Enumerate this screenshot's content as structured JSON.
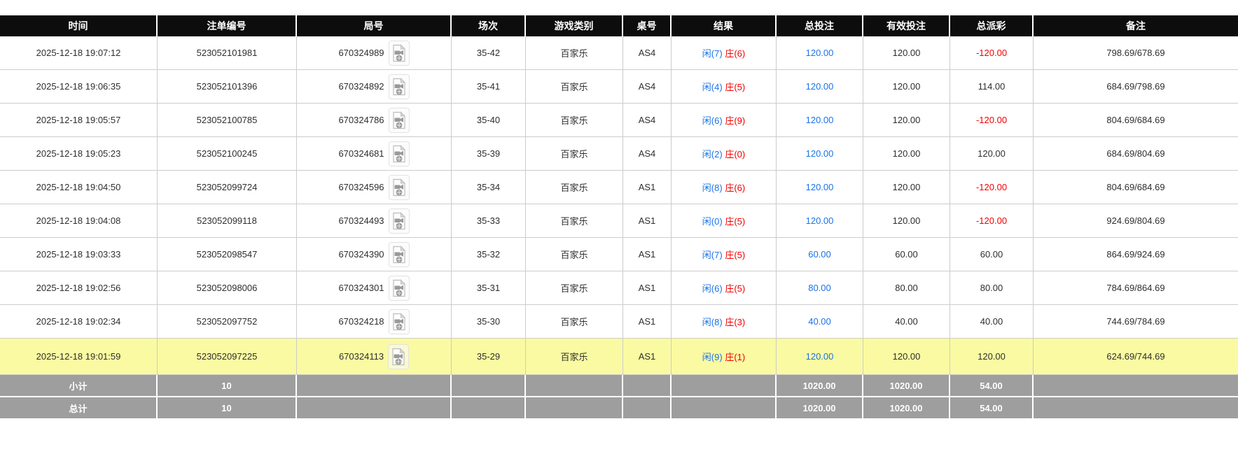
{
  "colors": {
    "header_bg": "#0d0d0d",
    "accent_blue": "#1a73e8",
    "negative_red": "#f20000",
    "highlight_yellow": "#fafaa2",
    "summary_gray": "#9e9e9e",
    "row_border": "#cccccc"
  },
  "table": {
    "columns": [
      {
        "key": "time",
        "label": "时间"
      },
      {
        "key": "bet_no",
        "label": "注单编号"
      },
      {
        "key": "round_no",
        "label": "局号"
      },
      {
        "key": "session",
        "label": "场次"
      },
      {
        "key": "game",
        "label": "游戏类别"
      },
      {
        "key": "table_no",
        "label": "桌号"
      },
      {
        "key": "result",
        "label": "结果"
      },
      {
        "key": "total_bet",
        "label": "总投注"
      },
      {
        "key": "valid_bet",
        "label": "有效投注"
      },
      {
        "key": "payout",
        "label": "总派彩"
      },
      {
        "key": "remark",
        "label": "备注"
      }
    ],
    "video_icon_name": "video-replay-icon",
    "rows": [
      {
        "time": "2025-12-18 19:07:12",
        "bet_no": "523052101981",
        "round_no": "670324989",
        "session": "35-42",
        "game": "百家乐",
        "table_no": "AS4",
        "result_player": "闲(7)",
        "result_banker": "庄(6)",
        "total_bet": "120.00",
        "valid_bet": "120.00",
        "payout": "-120.00",
        "remark": "798.69/678.69",
        "highlighted": false
      },
      {
        "time": "2025-12-18 19:06:35",
        "bet_no": "523052101396",
        "round_no": "670324892",
        "session": "35-41",
        "game": "百家乐",
        "table_no": "AS4",
        "result_player": "闲(4)",
        "result_banker": "庄(5)",
        "total_bet": "120.00",
        "valid_bet": "120.00",
        "payout": "114.00",
        "remark": "684.69/798.69",
        "highlighted": false
      },
      {
        "time": "2025-12-18 19:05:57",
        "bet_no": "523052100785",
        "round_no": "670324786",
        "session": "35-40",
        "game": "百家乐",
        "table_no": "AS4",
        "result_player": "闲(6)",
        "result_banker": "庄(9)",
        "total_bet": "120.00",
        "valid_bet": "120.00",
        "payout": "-120.00",
        "remark": "804.69/684.69",
        "highlighted": false
      },
      {
        "time": "2025-12-18 19:05:23",
        "bet_no": "523052100245",
        "round_no": "670324681",
        "session": "35-39",
        "game": "百家乐",
        "table_no": "AS4",
        "result_player": "闲(2)",
        "result_banker": "庄(0)",
        "total_bet": "120.00",
        "valid_bet": "120.00",
        "payout": "120.00",
        "remark": "684.69/804.69",
        "highlighted": false
      },
      {
        "time": "2025-12-18 19:04:50",
        "bet_no": "523052099724",
        "round_no": "670324596",
        "session": "35-34",
        "game": "百家乐",
        "table_no": "AS1",
        "result_player": "闲(8)",
        "result_banker": "庄(6)",
        "total_bet": "120.00",
        "valid_bet": "120.00",
        "payout": "-120.00",
        "remark": "804.69/684.69",
        "highlighted": false
      },
      {
        "time": "2025-12-18 19:04:08",
        "bet_no": "523052099118",
        "round_no": "670324493",
        "session": "35-33",
        "game": "百家乐",
        "table_no": "AS1",
        "result_player": "闲(0)",
        "result_banker": "庄(5)",
        "total_bet": "120.00",
        "valid_bet": "120.00",
        "payout": "-120.00",
        "remark": "924.69/804.69",
        "highlighted": false
      },
      {
        "time": "2025-12-18 19:03:33",
        "bet_no": "523052098547",
        "round_no": "670324390",
        "session": "35-32",
        "game": "百家乐",
        "table_no": "AS1",
        "result_player": "闲(7)",
        "result_banker": "庄(5)",
        "total_bet": "60.00",
        "valid_bet": "60.00",
        "payout": "60.00",
        "remark": "864.69/924.69",
        "highlighted": false
      },
      {
        "time": "2025-12-18 19:02:56",
        "bet_no": "523052098006",
        "round_no": "670324301",
        "session": "35-31",
        "game": "百家乐",
        "table_no": "AS1",
        "result_player": "闲(6)",
        "result_banker": "庄(5)",
        "total_bet": "80.00",
        "valid_bet": "80.00",
        "payout": "80.00",
        "remark": "784.69/864.69",
        "highlighted": false
      },
      {
        "time": "2025-12-18 19:02:34",
        "bet_no": "523052097752",
        "round_no": "670324218",
        "session": "35-30",
        "game": "百家乐",
        "table_no": "AS1",
        "result_player": "闲(8)",
        "result_banker": "庄(3)",
        "total_bet": "40.00",
        "valid_bet": "40.00",
        "payout": "40.00",
        "remark": "744.69/784.69",
        "highlighted": false
      },
      {
        "time": "2025-12-18 19:01:59",
        "bet_no": "523052097225",
        "round_no": "670324113",
        "session": "35-29",
        "game": "百家乐",
        "table_no": "AS1",
        "result_player": "闲(9)",
        "result_banker": "庄(1)",
        "total_bet": "120.00",
        "valid_bet": "120.00",
        "payout": "120.00",
        "remark": "624.69/744.69",
        "highlighted": true
      }
    ],
    "summary_rows": [
      {
        "label": "小计",
        "count": "10",
        "total_bet": "1020.00",
        "valid_bet": "1020.00",
        "payout": "54.00"
      },
      {
        "label": "总计",
        "count": "10",
        "total_bet": "1020.00",
        "valid_bet": "1020.00",
        "payout": "54.00"
      }
    ]
  }
}
